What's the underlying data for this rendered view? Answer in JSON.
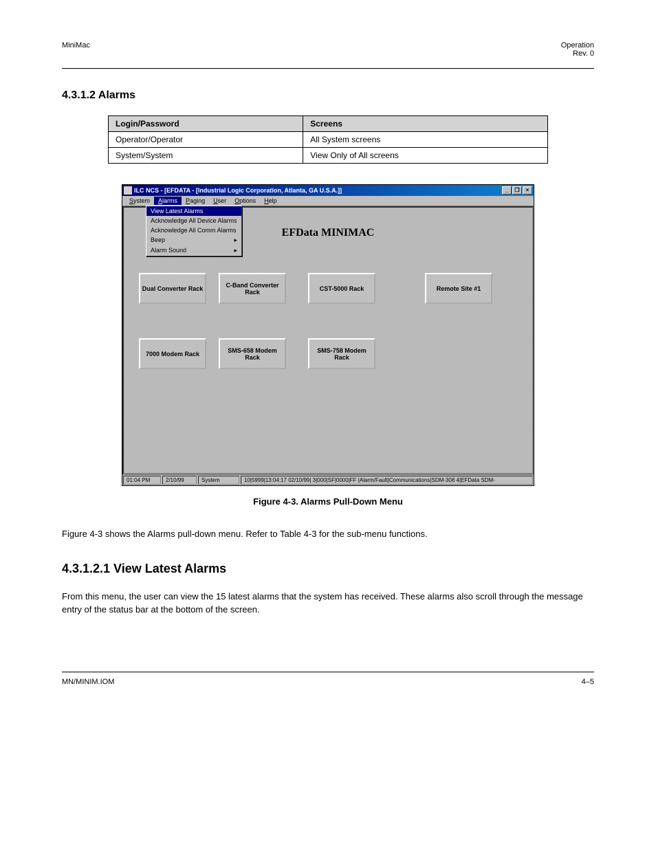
{
  "doc_header_left": "MiniMac",
  "doc_header_right": "Operation",
  "doc_header_rev": "Rev. 0",
  "subsection": "4.3.1.2 Alarms",
  "login_table": {
    "col1": "Login/Password",
    "col2": "Screens",
    "row1_c1": "Operator/Operator",
    "row1_c2": "All System screens",
    "row2_c1": "System/System",
    "row2_c2": "View Only of All screens"
  },
  "win_title": "ILC NCS - [EFDATA - [Industrial Logic Corporation, Atlanta, GA U.S.A.]]",
  "menu": {
    "system": "System",
    "alarms": "Alarms",
    "paging": "Paging",
    "user": "User",
    "options": "Options",
    "help": "Help"
  },
  "drop": {
    "view_latest": "View Latest Alarms",
    "ack_device": "Acknowledge All Device Alarms",
    "ack_comm": "Acknowledge All Comm Alarms",
    "beep": "Beep",
    "sound": "Alarm Sound"
  },
  "ws_title": "EFData MINIMAC",
  "r1": "Dual Converter Rack",
  "r2": "C-Band Converter Rack",
  "r3": "CST-5000 Rack",
  "r4": "Remote Site #1",
  "r5": "7000 Modem Rack",
  "r6": "SMS-658 Modem Rack",
  "r7": "SMS-758 Modem Rack",
  "status": {
    "time": "01:04 PM",
    "date": "2/10/99",
    "mode": "System",
    "msg1": "10|5999|13:04:17 02/10/99| 3|000|SF|0000|FF |Alarm/Fault|Communications|SDM-308 4|EFData SDM-"
  },
  "figure_caption": "Figure 4-3. Alarms Pull-Down Menu",
  "body": "Figure 4-3 shows the Alarms pull-down menu. Refer to Table 4-3 for the sub-menu functions.",
  "viewlatest_section": "4.3.1.2.1 View Latest Alarms",
  "viewlatest_body": "From this menu, the user can view the 15 latest alarms that the system has received. These alarms also scroll through the message entry of the status bar at the bottom of the screen.",
  "footer_page": "4–5",
  "footer_doc": "MN/MINIM.IOM"
}
